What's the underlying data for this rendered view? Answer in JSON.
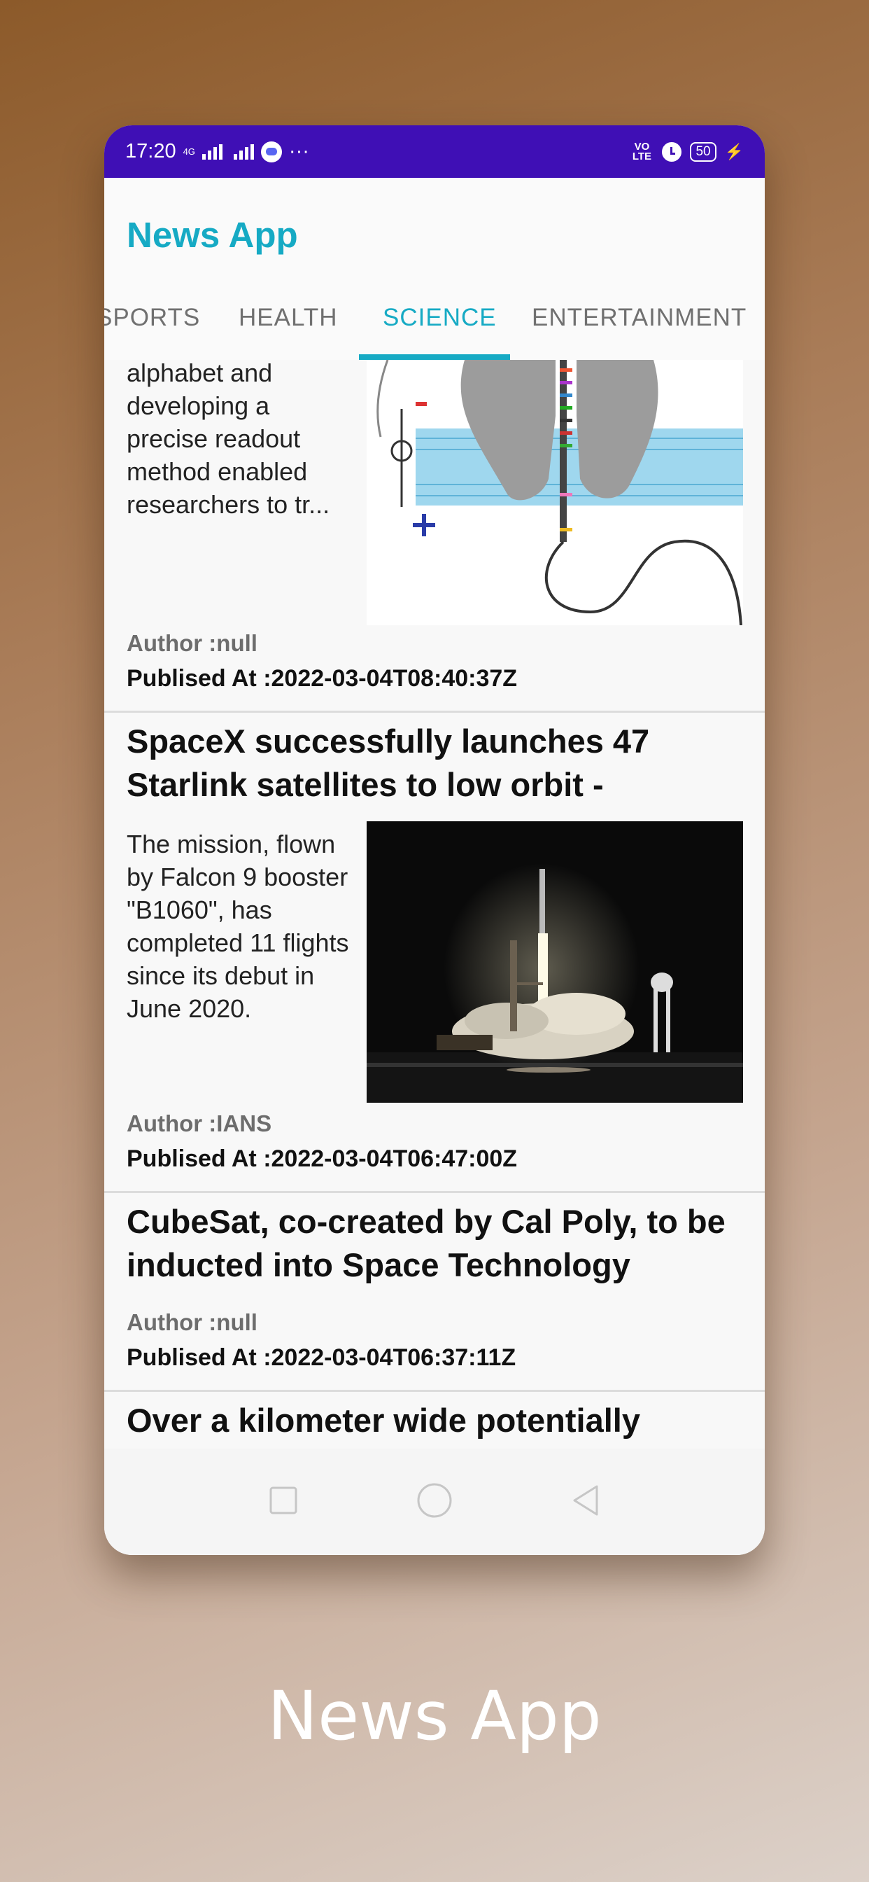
{
  "status_bar": {
    "time": "17:20",
    "network_label": "4G",
    "volte_label": "VO LTE",
    "battery_level": "50",
    "more_indicator": "···",
    "icons": [
      "signal-icon",
      "signal-icon",
      "discord-icon",
      "volte-icon",
      "alarm-icon",
      "battery-icon",
      "charging-icon"
    ]
  },
  "app_bar": {
    "title": "News App"
  },
  "tabs": [
    {
      "label": "SPORTS",
      "active": false
    },
    {
      "label": "HEALTH",
      "active": false
    },
    {
      "label": "SCIENCE",
      "active": true
    },
    {
      "label": "ENTERTAINMENT",
      "active": false
    }
  ],
  "articles": [
    {
      "title": "",
      "description": "alphabet and developing a precise readout method enabled researchers to tr...",
      "image": "nanopore-diagram",
      "author": "Author :null",
      "published": "Publised At :2022-03-04T08:40:37Z"
    },
    {
      "title": "SpaceX successfully launches 47 Starlink satellites to low orbit -",
      "description": "The mission, flown by Falcon 9 booster \"B1060\", has completed 11 flights since its debut in June 2020.",
      "image": "rocket-launch-photo",
      "author": "Author :IANS",
      "published": "Publised At :2022-03-04T06:47:00Z"
    },
    {
      "title": "CubeSat, co-created by Cal Poly, to be inducted into Space Technology",
      "author": "Author :null",
      "published": "Publised At :2022-03-04T06:37:11Z"
    },
    {
      "title": "Over a kilometer wide potentially"
    }
  ],
  "nav_bar": {
    "icons": [
      "recents-icon",
      "home-icon",
      "back-icon"
    ]
  },
  "caption": "News App",
  "colors": {
    "accent": "#16aac4",
    "status_bar": "#3f0fb5"
  }
}
